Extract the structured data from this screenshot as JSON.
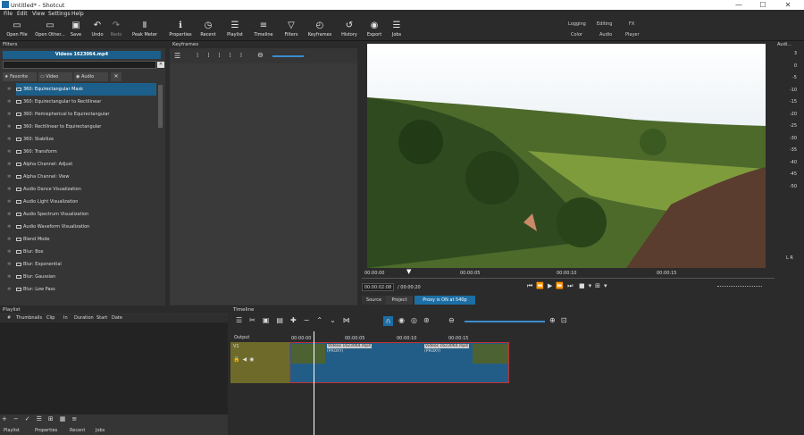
{
  "window": {
    "title": "Untitled* - Shotcut",
    "minimize": "—",
    "maximize": "☐",
    "close": "✕"
  },
  "menu": [
    "File",
    "Edit",
    "View",
    "Settings",
    "Help"
  ],
  "toolbar": [
    {
      "label": "Open File",
      "icon": "▭"
    },
    {
      "label": "Open Other...",
      "icon": "▭"
    },
    {
      "label": "Save",
      "icon": "▣"
    },
    {
      "label": "Undo",
      "icon": "↶"
    },
    {
      "label": "Redo",
      "icon": "↷"
    },
    {
      "label": "Peak Meter",
      "icon": "Ⅱ"
    },
    {
      "label": "Properties",
      "icon": "ℹ"
    },
    {
      "label": "Recent",
      "icon": "◷"
    },
    {
      "label": "Playlist",
      "icon": "☰"
    },
    {
      "label": "Timeline",
      "icon": "≡"
    },
    {
      "label": "Filters",
      "icon": "▽"
    },
    {
      "label": "Keyframes",
      "icon": "◴"
    },
    {
      "label": "History",
      "icon": "↺"
    },
    {
      "label": "Export",
      "icon": "◉"
    },
    {
      "label": "Jobs",
      "icon": "☰"
    }
  ],
  "layouts": {
    "logging": "Logging",
    "editing": "Editing",
    "fx": "FX",
    "color": "Color",
    "audio": "Audio",
    "player": "Player"
  },
  "filters": {
    "title": "Filters",
    "clip_name": "Videos 1623064.mp4",
    "search_value": "",
    "tabs": {
      "favorite": "Favorite",
      "video": "Video",
      "audio": "Audio"
    },
    "items": [
      "360: Equirectangular Mask",
      "360: Equirectangular to Rectilinear",
      "360: Hemispherical to Equirectangular",
      "360: Rectilinear to Equirectangular",
      "360: Stabilize",
      "360: Transform",
      "Alpha Channel: Adjust",
      "Alpha Channel: View",
      "Audio Dance Visualization",
      "Audio Light Visualization",
      "Audio Spectrum Visualization",
      "Audio Waveform Visualization",
      "Blend Mode",
      "Blur: Box",
      "Blur: Exponential",
      "Blur: Gaussian",
      "Blur: Low Pass"
    ],
    "selected_index": 0
  },
  "keyframes": {
    "title": "Keyframes"
  },
  "viewer": {
    "ruler_ticks": [
      "00:00:00",
      "00:00:05",
      "00:00:10",
      "00:00:15"
    ],
    "current_time": "00:00:02:08",
    "total_time": "/ 00:00:20",
    "tab_source": "Source",
    "tab_project": "Project",
    "proxy_badge": "Proxy is ON at 540p",
    "colors": {
      "proxy": "#1c6ea4"
    }
  },
  "audio_meter": {
    "title": "Audi...",
    "ticks": [
      "3",
      "0",
      "-5",
      "-10",
      "-15",
      "-20",
      "-25",
      "-30",
      "-35",
      "-40",
      "-45",
      "-50"
    ],
    "channels": "L R"
  },
  "playlist": {
    "title": "Playlist",
    "columns": [
      "#",
      "Thumbnails",
      "Clip",
      "In",
      "Duration",
      "Start",
      "Date"
    ],
    "tabs": [
      "Playlist",
      "Properties",
      "Recent",
      "Jobs"
    ]
  },
  "timeline": {
    "title": "Timeline",
    "output_label": "Output",
    "track_name": "V1",
    "ruler_ticks": [
      "00:00:00",
      "00:00:05",
      "00:00:10",
      "00:00:15"
    ],
    "clips": [
      {
        "name": "Videos 1623064.mp4",
        "note": "(PROXY)"
      },
      {
        "name": "Videos 1623064.mp4",
        "note": "(PROXY)"
      }
    ]
  }
}
